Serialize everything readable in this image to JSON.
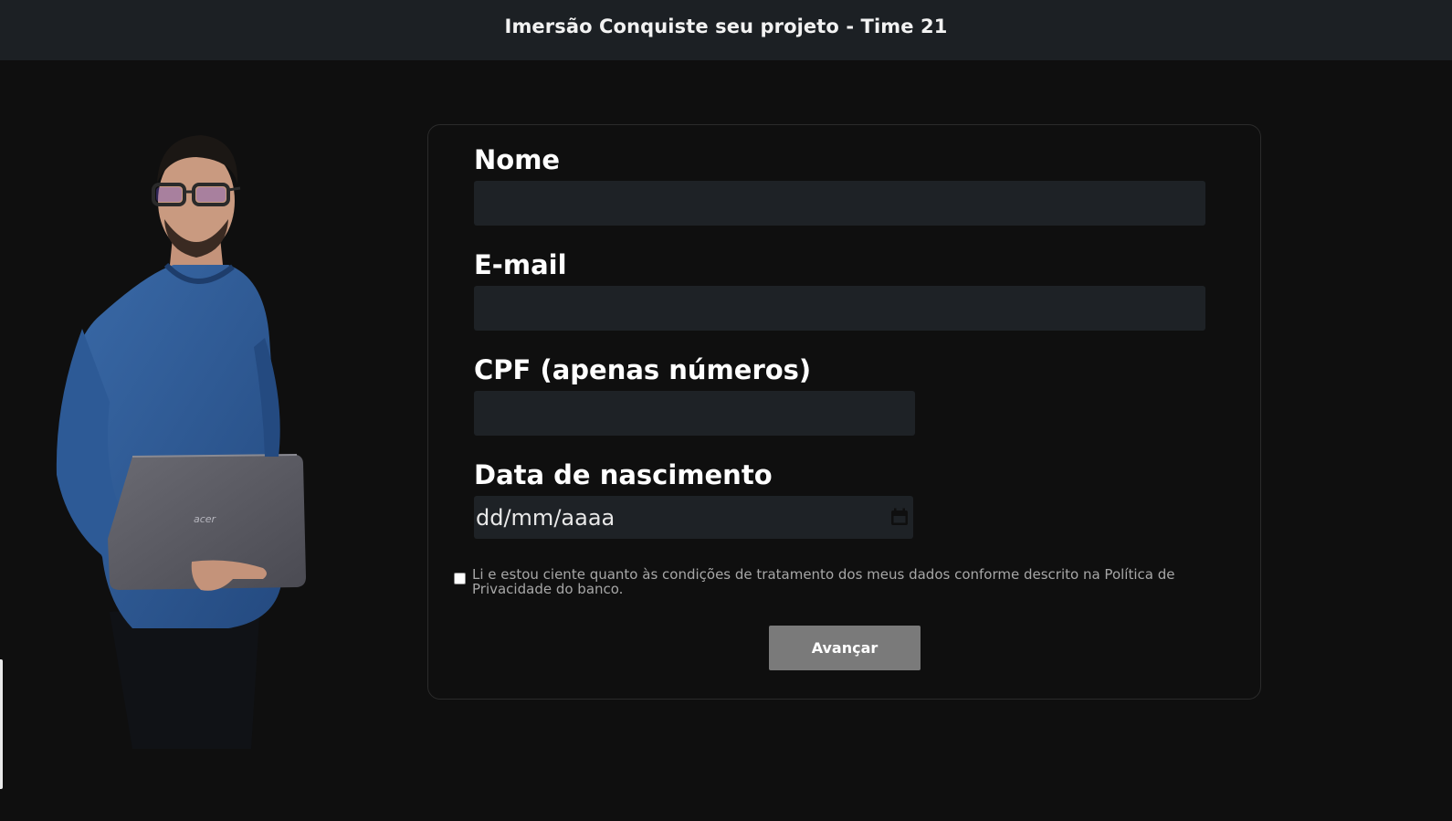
{
  "header": {
    "title": "Imersão Conquiste seu projeto - Time 21"
  },
  "form": {
    "fields": [
      {
        "label": "Nome",
        "value": "",
        "placeholder": ""
      },
      {
        "label": "E-mail",
        "value": "",
        "placeholder": ""
      },
      {
        "label": "CPF (apenas números)",
        "value": "",
        "placeholder": ""
      },
      {
        "label": "Data de nascimento",
        "value": "dd/mm/aaaa",
        "placeholder": "dd/mm/aaaa"
      }
    ],
    "consent": {
      "checked": false,
      "text": "Li e estou ciente quanto às condições de tratamento dos meus dados conforme descrito na Política de Privacidade do banco."
    },
    "submit_label": "Avançar"
  },
  "icons": {
    "date_picker": "calendar-icon"
  },
  "colors": {
    "page_background": "#0f0f0f",
    "header_background": "#1c2024",
    "input_background": "#1e2226",
    "button_background": "#7a7a7a",
    "sweater_blue": "#2f5b96"
  }
}
